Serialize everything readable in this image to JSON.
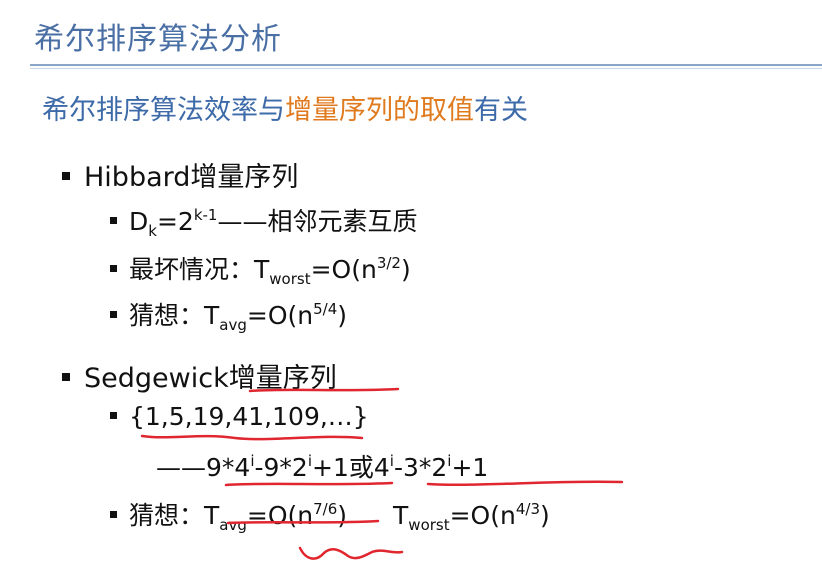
{
  "slide": {
    "title": "希尔排序算法分析",
    "subtitle": {
      "prefix": "希尔排序算法效率与",
      "highlight": "增量序列的取值",
      "suffix": "有关"
    },
    "colors": {
      "title": "#4a6fa5",
      "subtitle": "#3d6aa8",
      "highlight": "#e07a1f",
      "ink": "#e0262e"
    },
    "hibbard": {
      "heading": "Hibbard增量序列",
      "item1": {
        "d": "D",
        "d_sub": "k",
        "eq": "=2",
        "exp": "k-1",
        "tail": "——相邻元素互质"
      },
      "item2": {
        "label": "最坏情况：T",
        "sub": "worst",
        "eq": "=O(n",
        "exp": "3/2",
        "close": ")"
      },
      "item3": {
        "label": "猜想：T",
        "sub": "avg",
        "eq": "=O(n",
        "exp": "5/4",
        "close": ")"
      }
    },
    "sedgewick": {
      "heading": "Sedgewick增量序列",
      "item1": "{1,5,19,41,109,…}",
      "formula": {
        "p1": "——9*4",
        "e1": "i",
        "p2": "-9*2",
        "e2": "i",
        "p3": "+1或4",
        "e3": "i",
        "p4": "-3*2",
        "e4": "i",
        "p5": "+1"
      },
      "item2": {
        "label": "猜想：T",
        "sub": "avg",
        "eq": "=O(n",
        "exp": "7/6",
        "close": ")",
        "label2": "T",
        "sub2": "worst",
        "eq2": "=O(n",
        "exp2": "4/3",
        "close2": ")"
      }
    }
  }
}
